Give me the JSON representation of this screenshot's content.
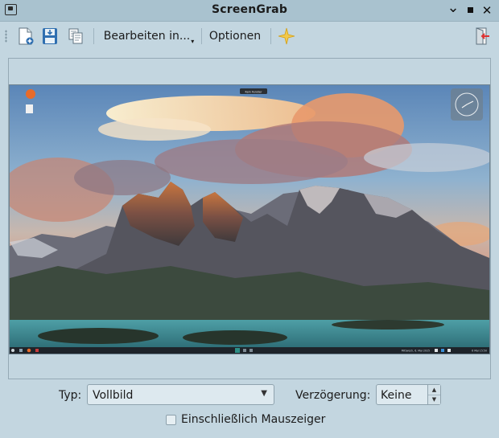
{
  "window": {
    "title": "ScreenGrab"
  },
  "toolbar": {
    "new_icon": "new-screenshot-icon",
    "save_icon": "save-icon",
    "copy_icon": "copy-icon",
    "edit_label": "Bearbeiten in...",
    "options_label": "Optionen",
    "about_icon": "star-icon",
    "quit_icon": "quit-icon"
  },
  "preview": {
    "desktop_tooltip_text": "Kein Fenster",
    "taskbar_tray_text": "Mittwoch, 6. Mai 2025"
  },
  "form": {
    "type_label": "Typ:",
    "type_value": "Vollbild",
    "delay_label": "Verzögerung:",
    "delay_value": "Keine",
    "include_cursor_label": "Einschließlich Mauszeiger",
    "include_cursor_checked": false
  },
  "colors": {
    "window_bg": "#c3d6e0",
    "titlebar_bg": "#a9c2cf"
  }
}
